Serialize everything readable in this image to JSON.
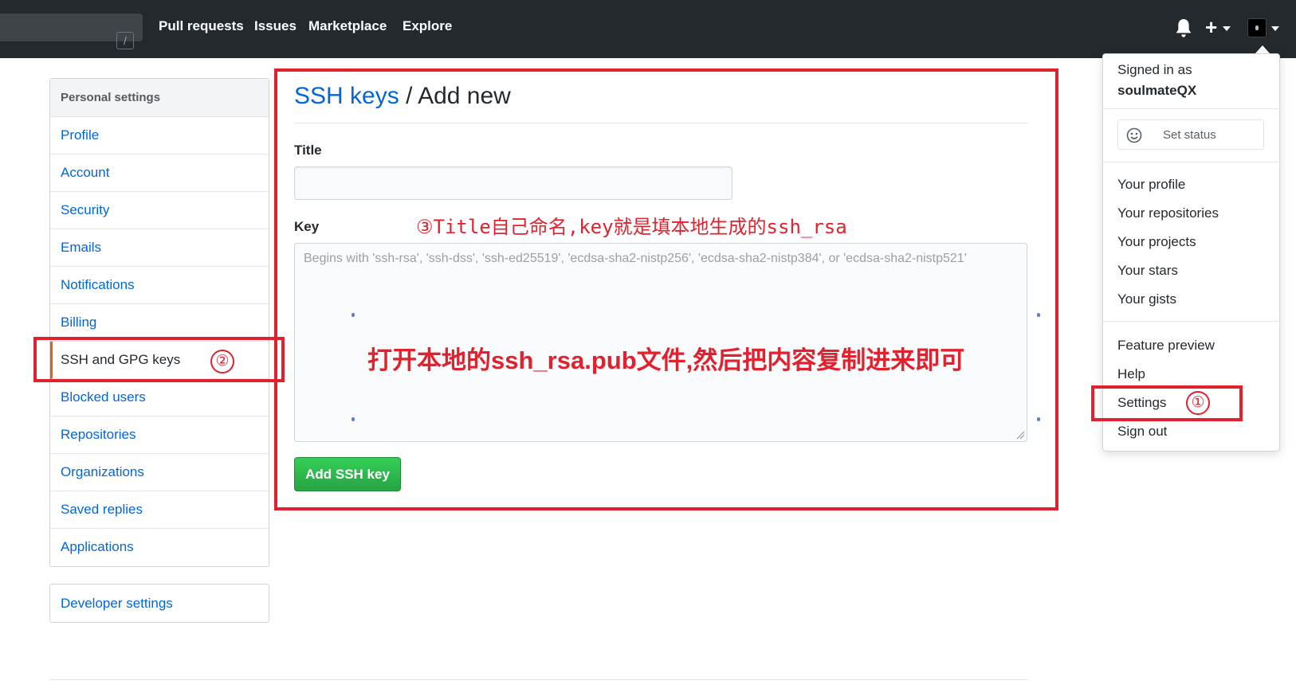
{
  "header": {
    "search_shortcut": "/",
    "nav": [
      "Pull requests",
      "Issues",
      "Marketplace",
      "Explore"
    ],
    "icons": [
      "bell-icon",
      "plus-icon",
      "avatar"
    ]
  },
  "sidebar": {
    "heading": "Personal settings",
    "items": [
      {
        "label": "Profile"
      },
      {
        "label": "Account"
      },
      {
        "label": "Security"
      },
      {
        "label": "Emails"
      },
      {
        "label": "Notifications"
      },
      {
        "label": "Billing"
      },
      {
        "label": "SSH and GPG keys",
        "selected": true
      },
      {
        "label": "Blocked users"
      },
      {
        "label": "Repositories"
      },
      {
        "label": "Organizations"
      },
      {
        "label": "Saved replies"
      },
      {
        "label": "Applications"
      }
    ],
    "developer_settings": "Developer settings"
  },
  "main": {
    "title_link": "SSH keys",
    "title_sep": "/",
    "title_rest": "Add new",
    "title_label": "Title",
    "title_value": "",
    "key_label": "Key",
    "key_placeholder": "Begins with 'ssh-rsa', 'ssh-dss', 'ssh-ed25519', 'ecdsa-sha2-nistp256', 'ecdsa-sha2-nistp384', or 'ecdsa-sha2-nistp521'",
    "submit_label": "Add SSH key"
  },
  "dropdown": {
    "signed_in_as": "Signed in as",
    "username": "soulmateQX",
    "set_status": "Set status",
    "items_group1": [
      "Your profile",
      "Your repositories",
      "Your projects",
      "Your stars",
      "Your gists"
    ],
    "items_group2": [
      "Feature preview",
      "Help",
      "Settings",
      "Sign out"
    ]
  },
  "annotations": {
    "step1": "①",
    "step2": "②",
    "step3_text": "③Title自己命名,key就是填本地生成的ssh_rsa",
    "key_hint": "打开本地的ssh_rsa.pub文件,然后把内容复制进来即可",
    "color": "#e0222e"
  },
  "colors": {
    "header_bg": "#24292e",
    "link": "#0366d6",
    "primary_button": "#28a745",
    "selected_accent": "#e36209"
  }
}
